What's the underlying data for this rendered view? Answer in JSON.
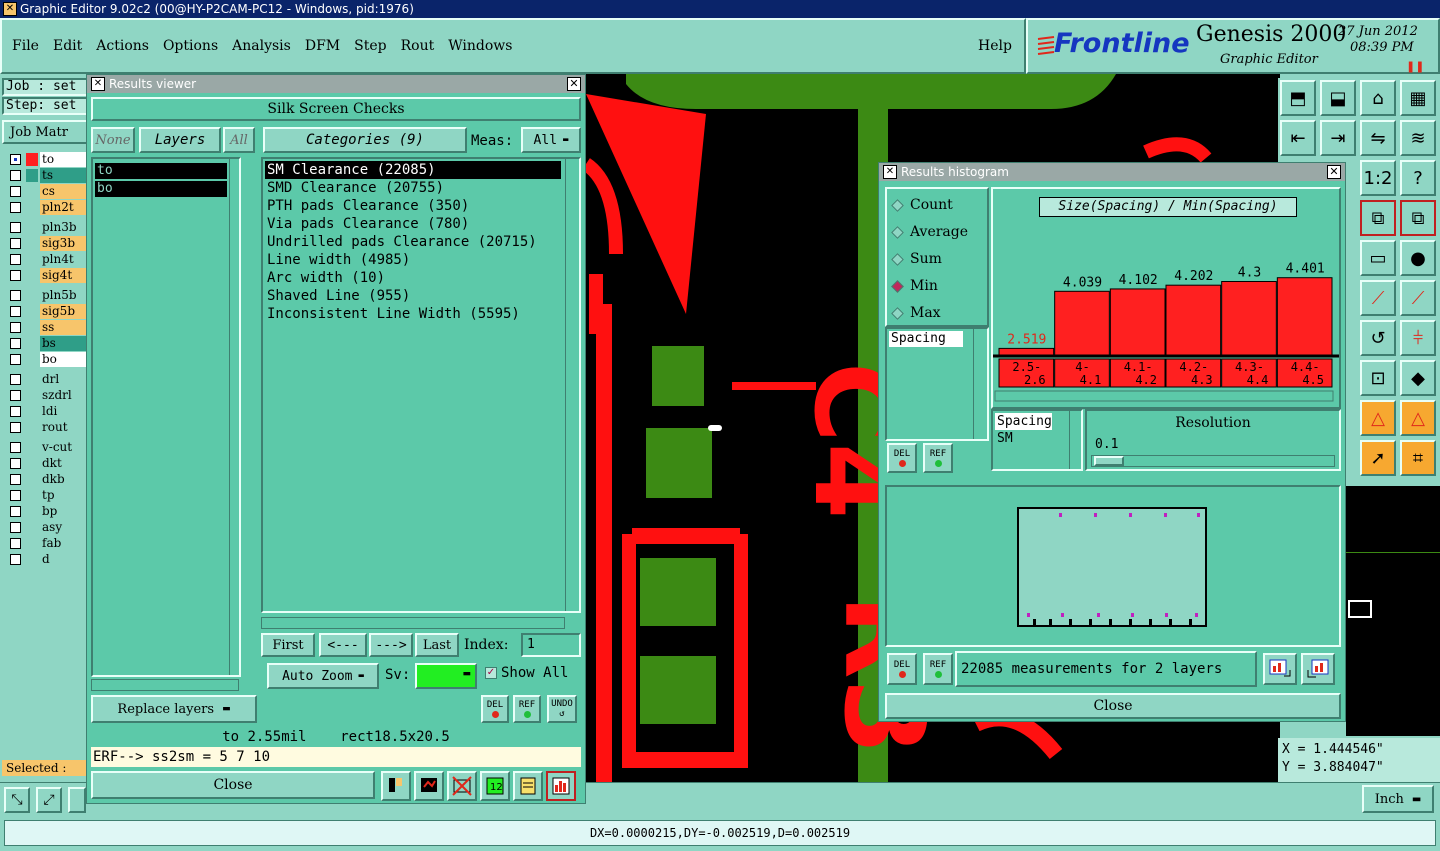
{
  "window": {
    "title": "Graphic Editor 9.02c2 (00@HY-P2CAM-PC12 - Windows, pid:1976)"
  },
  "menu": {
    "items": [
      "File",
      "Edit",
      "Actions",
      "Options",
      "Analysis",
      "DFM",
      "Step",
      "Rout",
      "Windows"
    ],
    "help": "Help"
  },
  "brand": {
    "logo": "Frontline",
    "product": "Genesis 2000",
    "subtitle": "Graphic Editor",
    "date": "27 Jun 2012",
    "time": "08:39 PM"
  },
  "left_panel": {
    "job_label": "Job : set",
    "step_label": "Step: set",
    "job_matrix": "Job Matr",
    "selected": "Selected :",
    "layers": [
      {
        "name": "to",
        "color": "#ffffff"
      },
      {
        "name": "ts",
        "color": "#2f9e88"
      },
      {
        "name": "cs",
        "color": "#f7c56b"
      },
      {
        "name": "pln2t",
        "color": "#f7c56b"
      },
      {
        "name": "pln3b",
        "color": "#8fd6c4"
      },
      {
        "name": "sig3b",
        "color": "#f7c56b"
      },
      {
        "name": "pln4t",
        "color": "#8fd6c4"
      },
      {
        "name": "sig4t",
        "color": "#f7c56b"
      },
      {
        "name": "pln5b",
        "color": "#8fd6c4"
      },
      {
        "name": "sig5b",
        "color": "#f7c56b"
      },
      {
        "name": "ss",
        "color": "#f7c56b"
      },
      {
        "name": "bs",
        "color": "#2f9e88"
      },
      {
        "name": "bo",
        "color": "#ffffff"
      },
      {
        "name": "drl",
        "color": "#8fd6c4"
      },
      {
        "name": "szdrl",
        "color": "#8fd6c4"
      },
      {
        "name": "ldi",
        "color": "#8fd6c4"
      },
      {
        "name": "rout",
        "color": "#8fd6c4"
      },
      {
        "name": "v-cut",
        "color": "#8fd6c4"
      },
      {
        "name": "dkt",
        "color": "#8fd6c4"
      },
      {
        "name": "dkb",
        "color": "#8fd6c4"
      },
      {
        "name": "tp",
        "color": "#8fd6c4"
      },
      {
        "name": "bp",
        "color": "#8fd6c4"
      },
      {
        "name": "asy",
        "color": "#8fd6c4"
      },
      {
        "name": "fab",
        "color": "#8fd6c4"
      },
      {
        "name": "d",
        "color": "#8fd6c4"
      }
    ]
  },
  "results_viewer": {
    "title": "Results viewer",
    "header": "Silk Screen Checks",
    "none_btn": "None",
    "layers_btn": "Layers",
    "all_btn": "All",
    "categories_btn": "Categories (9)",
    "meas_label": "Meas:",
    "meas_value": "All",
    "layer_items": [
      "to",
      "bo"
    ],
    "categories": [
      "SM Clearance (22085)",
      "SMD Clearance (20755)",
      "PTH pads Clearance (350)",
      "Via pads Clearance (780)",
      "Undrilled pads Clearance (20715)",
      "Line width (4985)",
      "Arc width (10)",
      "Shaved Line (955)",
      "Inconsistent Line Width (5595)"
    ],
    "nav": {
      "first": "First",
      "prev": "<---",
      "next": "--->",
      "last": "Last",
      "index_label": "Index:",
      "index_value": "1"
    },
    "auto_zoom": "Auto Zoom",
    "sv_label": "Sv:",
    "show_all": "Show All",
    "replace_layers": "Replace layers",
    "del": "DEL",
    "ref": "REF",
    "undo": "UNDO",
    "status": "to 2.55mil    rect18.5x20.5",
    "erf": "ERF--> ss2sm = 5 7 10",
    "close": "Close"
  },
  "histogram": {
    "title": "Results histogram",
    "radio": [
      "Count",
      "Average",
      "Sum",
      "Min",
      "Max"
    ],
    "selected_radio": "Min",
    "chart_title": "Size(Spacing) / Min(Spacing)",
    "spacing_item": "Spacing",
    "list2": [
      "Spacing",
      "SM"
    ],
    "resolution_label": "Resolution",
    "resolution_value": "0.1",
    "del": "DEL",
    "ref": "REF",
    "measurements": "22085 measurements for 2 layers",
    "close": "Close"
  },
  "chart_data": {
    "type": "bar",
    "title": "Size(Spacing) / Min(Spacing)",
    "categories": [
      "2.5-2.6",
      "4-4.1",
      "4.1-4.2",
      "4.2-4.3",
      "4.3-4.4",
      "4.4-4.5"
    ],
    "category_top": [
      "2.5-",
      "4-",
      "4.1-",
      "4.2-",
      "4.3-",
      "4.4-"
    ],
    "category_bottom": [
      "2.6",
      "4.1",
      "4.2",
      "4.3",
      "4.4",
      "4.5"
    ],
    "values": [
      2.519,
      4.039,
      4.102,
      4.202,
      4.3,
      4.401
    ],
    "labels": [
      "2.519",
      "4.039",
      "4.102",
      "4.202",
      "4.3",
      "4.401"
    ],
    "ylim": [
      0,
      5.2
    ],
    "bar_color": "#ff2020"
  },
  "coords": {
    "x": "X = 1.444546\"",
    "y": "Y = 3.884047\""
  },
  "unit": "Inch",
  "bottom_status": "DX=0.0000215,DY=-0.002519,D=0.002519"
}
